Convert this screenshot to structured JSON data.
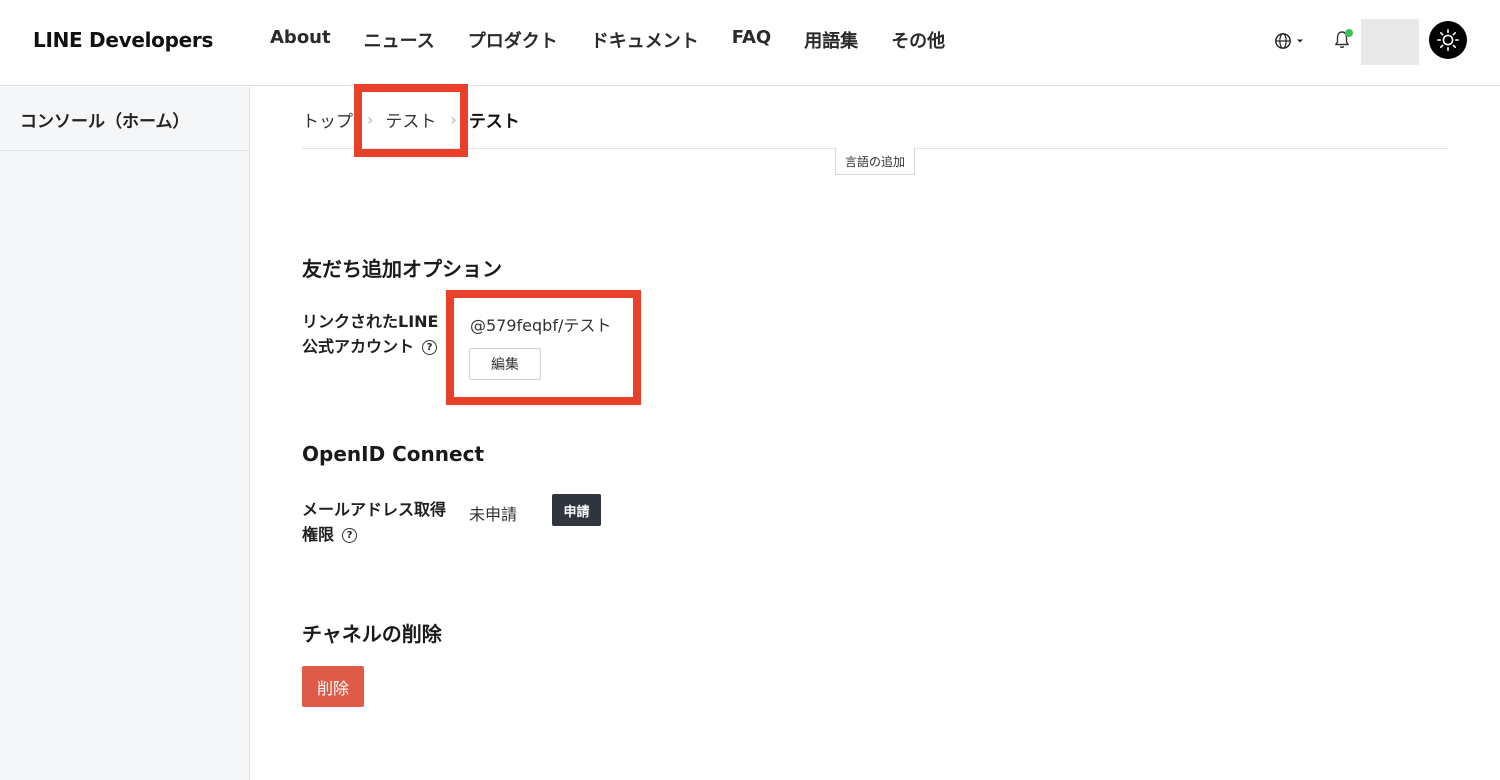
{
  "header": {
    "brand": "LINE Developers",
    "nav": [
      "About",
      "ニュース",
      "プロダクト",
      "ドキュメント",
      "FAQ",
      "用語集",
      "その他"
    ],
    "icons": [
      "globe-icon",
      "bell-icon",
      "sun-icon"
    ],
    "notification_dot_color": "#3fc25d"
  },
  "sidebar": {
    "items": [
      {
        "label": "コンソール（ホーム）"
      }
    ]
  },
  "breadcrumb": {
    "items": [
      "トップ",
      "テスト",
      "テスト"
    ],
    "separator": "›"
  },
  "language": {
    "add_label": "言語の追加"
  },
  "friend_option": {
    "title": "友だち追加オプション",
    "linked_label_line1": "リンクされたLINE",
    "linked_label_line2": "公式アカウント",
    "linked_value": "@579feqbf/テスト",
    "edit_label": "編集"
  },
  "openid": {
    "title": "OpenID Connect",
    "email_label_line1": "メールアドレス取得",
    "email_label_line2": "権限",
    "email_status": "未申請",
    "apply_label": "申請"
  },
  "delete_section": {
    "title": "チャネルの削除",
    "delete_label": "削除",
    "button_color": "#de5a49"
  },
  "annotations": {
    "highlight_color": "#e8412a"
  },
  "help_glyph": "?"
}
